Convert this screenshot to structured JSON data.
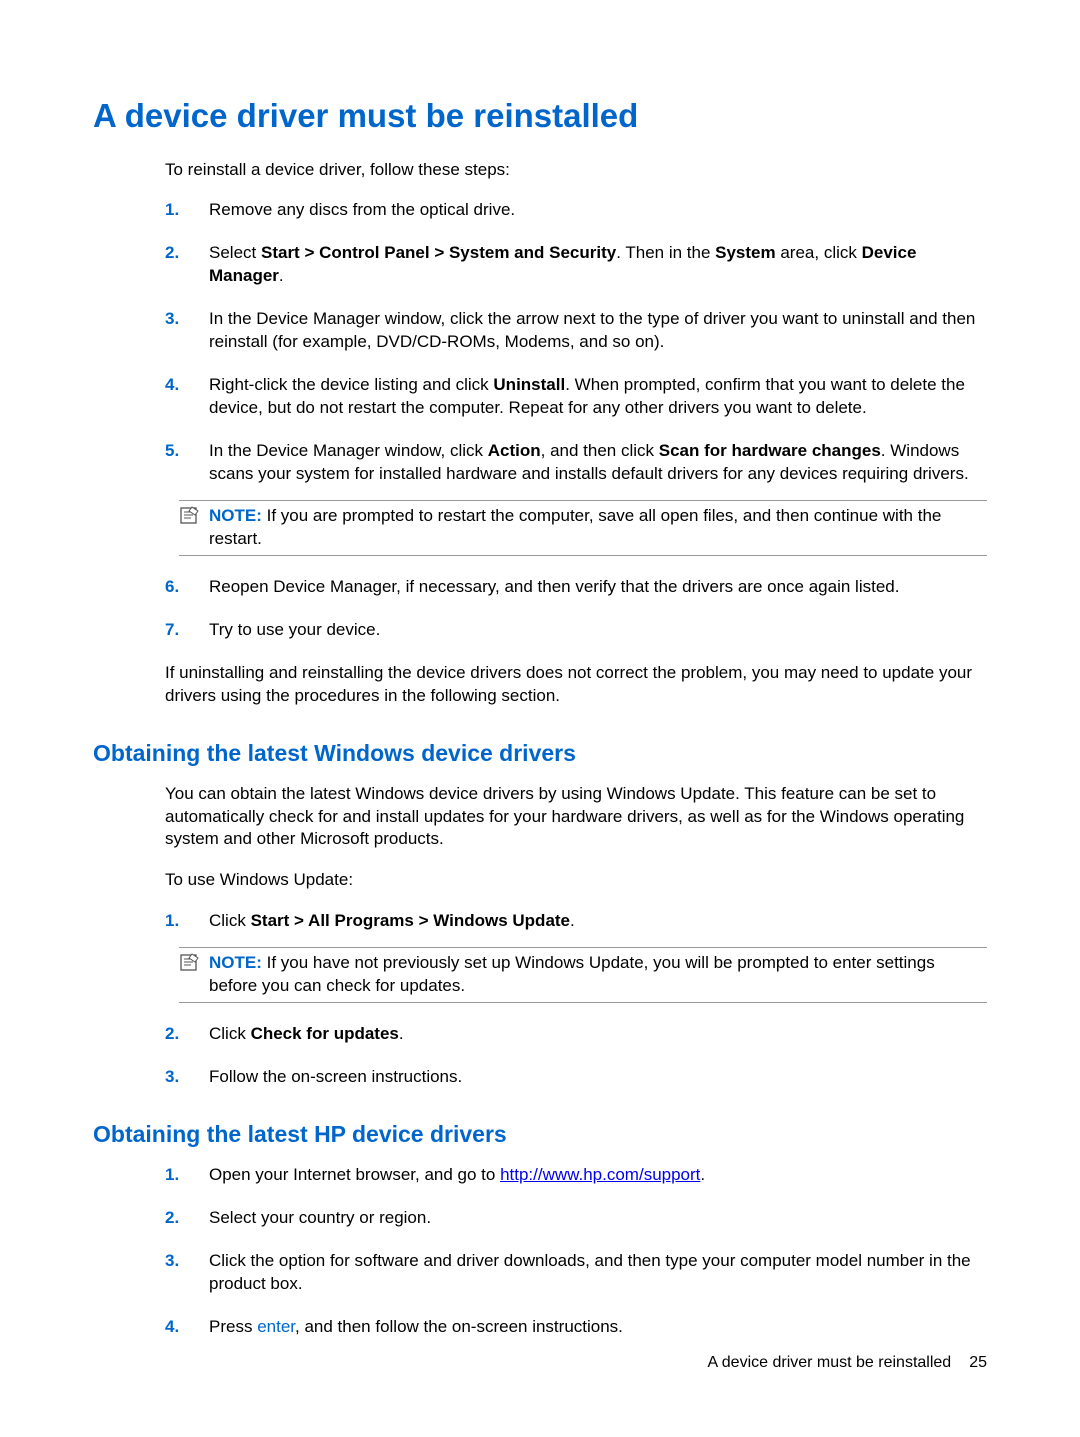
{
  "h1": "A device driver must be reinstalled",
  "intro1": "To reinstall a device driver, follow these steps:",
  "list1": [
    {
      "text": "Remove any discs from the optical drive."
    },
    {
      "prefix": "Select ",
      "bold1": "Start > Control Panel > System and Security",
      "mid": ". Then in the ",
      "bold2": "System",
      "mid2": " area, click ",
      "bold3": "Device Manager",
      "suffix": "."
    },
    {
      "text": "In the Device Manager window, click the arrow next to the type of driver you want to uninstall and then reinstall (for example, DVD/CD-ROMs, Modems, and so on)."
    },
    {
      "prefix": "Right-click the device listing and click ",
      "bold1": "Uninstall",
      "suffix": ". When prompted, confirm that you want to delete the device, but do not restart the computer. Repeat for any other drivers you want to delete."
    },
    {
      "prefix": "In the Device Manager window, click ",
      "bold1": "Action",
      "mid": ", and then click ",
      "bold2": "Scan for hardware changes",
      "suffix": ". Windows scans your system for installed hardware and installs default drivers for any devices requiring drivers.",
      "note": {
        "label": "NOTE:",
        "text": "If you are prompted to restart the computer, save all open files, and then continue with the restart."
      }
    },
    {
      "text": "Reopen Device Manager, if necessary, and then verify that the drivers are once again listed."
    },
    {
      "text": "Try to use your device."
    }
  ],
  "para1": "If uninstalling and reinstalling the device drivers does not correct the problem, you may need to update your drivers using the procedures in the following section.",
  "h2a": "Obtaining the latest Windows device drivers",
  "para2": "You can obtain the latest Windows device drivers by using Windows Update. This feature can be set to automatically check for and install updates for your hardware drivers, as well as for the Windows operating system and other Microsoft products.",
  "para3": "To use Windows Update:",
  "list2": [
    {
      "prefix": "Click ",
      "bold1": "Start > All Programs > Windows Update",
      "suffix": ".",
      "note": {
        "label": "NOTE:",
        "text": "If you have not previously set up Windows Update, you will be prompted to enter settings before you can check for updates."
      }
    },
    {
      "prefix": "Click ",
      "bold1": "Check for updates",
      "suffix": "."
    },
    {
      "text": "Follow the on-screen instructions."
    }
  ],
  "h2b": "Obtaining the latest HP device drivers",
  "list3": [
    {
      "prefix": "Open your Internet browser, and go to ",
      "linkText": "http://www.hp.com/support",
      "linkHref": "http://www.hp.com/support",
      "suffix": "."
    },
    {
      "text": "Select your country or region."
    },
    {
      "text": "Click the option for software and driver downloads, and then type your computer model number in the product box."
    },
    {
      "prefix": "Press ",
      "key": "enter",
      "suffix": ", and then follow the on-screen instructions."
    }
  ],
  "footer": {
    "title": "A device driver must be reinstalled",
    "page": "25"
  }
}
